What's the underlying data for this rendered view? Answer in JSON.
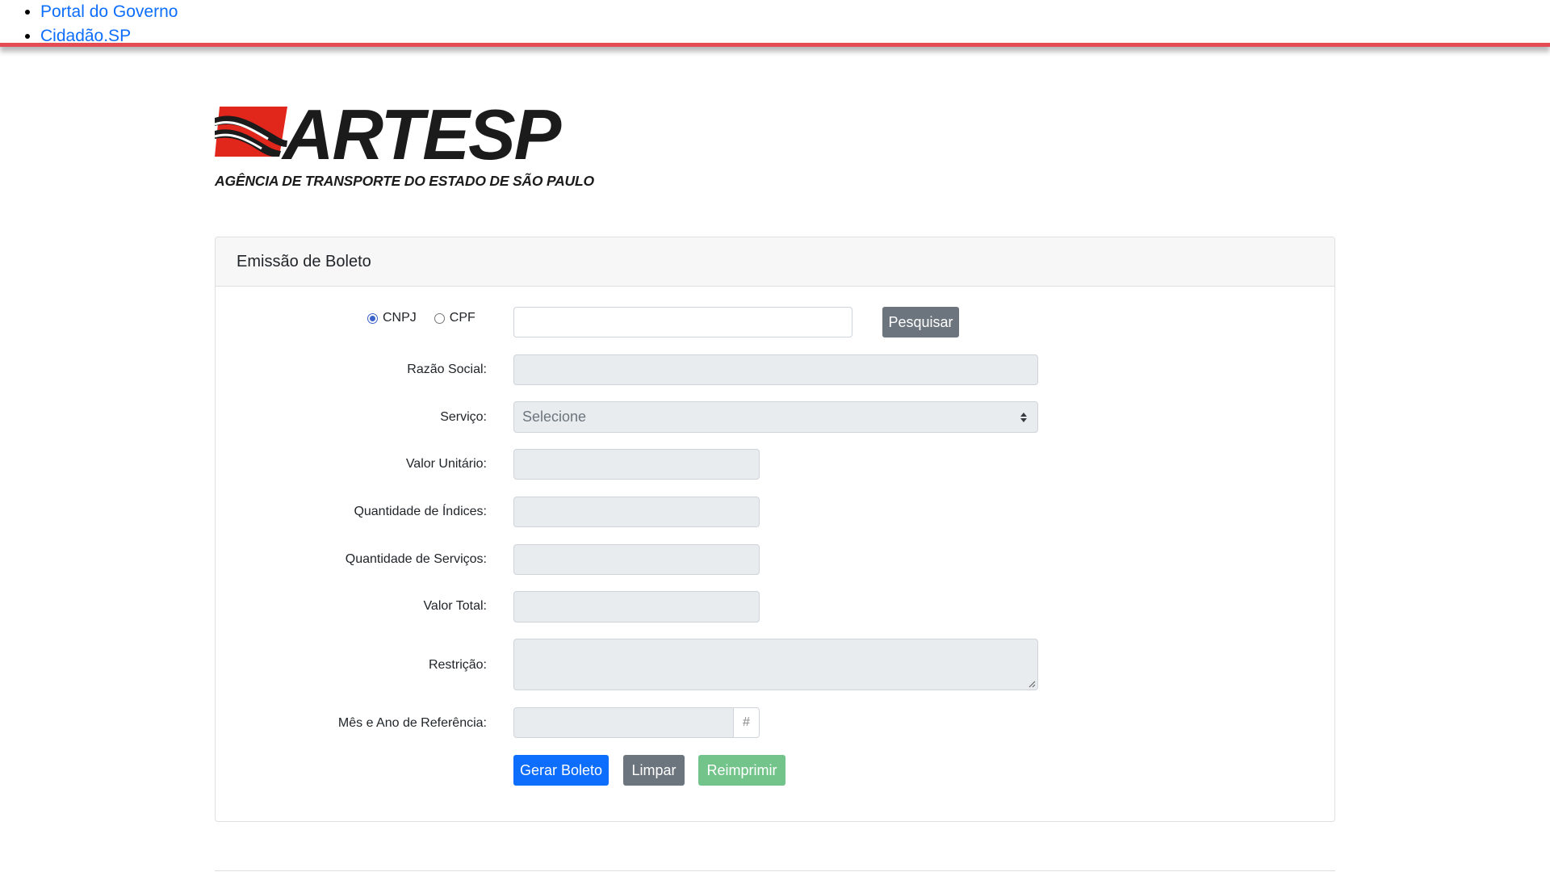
{
  "nav": {
    "links": [
      "Portal do Governo",
      "Cidadão.SP"
    ]
  },
  "logo": {
    "wordmark": "ARTESP",
    "tagline": "AGÊNCIA DE TRANSPORTE DO ESTADO DE SÃO PAULO"
  },
  "card": {
    "title": "Emissão de Boleto",
    "doc_type": {
      "options": [
        "CNPJ",
        "CPF"
      ],
      "selected": "CNPJ"
    },
    "search_value": "",
    "search_button": "Pesquisar",
    "fields": {
      "razao_social": {
        "label": "Razão Social:",
        "value": ""
      },
      "servico": {
        "label": "Serviço:",
        "value": "Selecione"
      },
      "valor_unitario": {
        "label": "Valor Unitário:",
        "value": ""
      },
      "qtd_indices": {
        "label": "Quantidade de Índices:",
        "value": ""
      },
      "qtd_servicos": {
        "label": "Quantidade de Serviços:",
        "value": ""
      },
      "valor_total": {
        "label": "Valor Total:",
        "value": ""
      },
      "restricao": {
        "label": "Restrição:",
        "value": ""
      },
      "mes_ano": {
        "label": "Mês e Ano de Referência:",
        "value": "",
        "addon": "#"
      }
    },
    "buttons": {
      "gerar": "Gerar Boleto",
      "limpar": "Limpar",
      "reimprimir": "Reimprimir"
    }
  },
  "colors": {
    "accent_red": "#e44b52",
    "primary": "#0d6efd",
    "secondary": "#6c757d",
    "success_disabled": "#72c48a"
  }
}
